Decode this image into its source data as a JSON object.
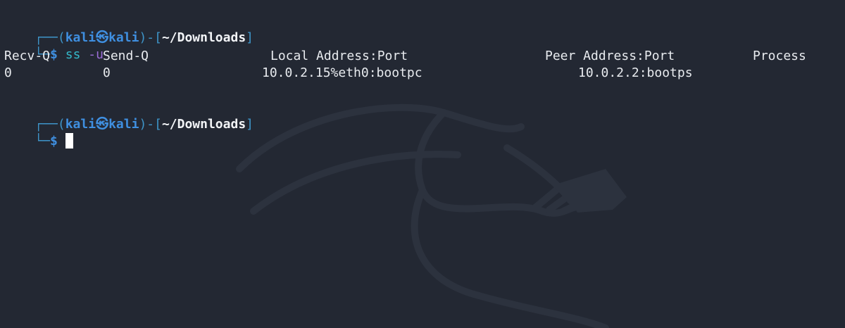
{
  "prompt": {
    "open_bracket": "┌──(",
    "user": "kali",
    "skull": "㉿",
    "host": "kali",
    "mid": ")-[",
    "path": "~/Downloads",
    "close": "]",
    "corner": "└─",
    "dollar": "$"
  },
  "command": {
    "name": "ss",
    "flag": "-u"
  },
  "table": {
    "headers": {
      "recvq": "Recv-Q",
      "sendq": "Send-Q",
      "local": "Local Address:Port",
      "peer": "Peer Address:Port",
      "process": "Process"
    },
    "rows": [
      {
        "recvq": "0",
        "sendq": "0",
        "local": "10.0.2.15%eth0:bootpc",
        "peer": "10.0.2.2:bootps",
        "process": ""
      }
    ]
  },
  "colors": {
    "background": "#232833",
    "frame": "#3e95c9",
    "user": "#3f8fe0",
    "command": "#34b8c9",
    "flag": "#9a6dd6"
  },
  "icons": {
    "background": "kali-dragon-watermark"
  }
}
